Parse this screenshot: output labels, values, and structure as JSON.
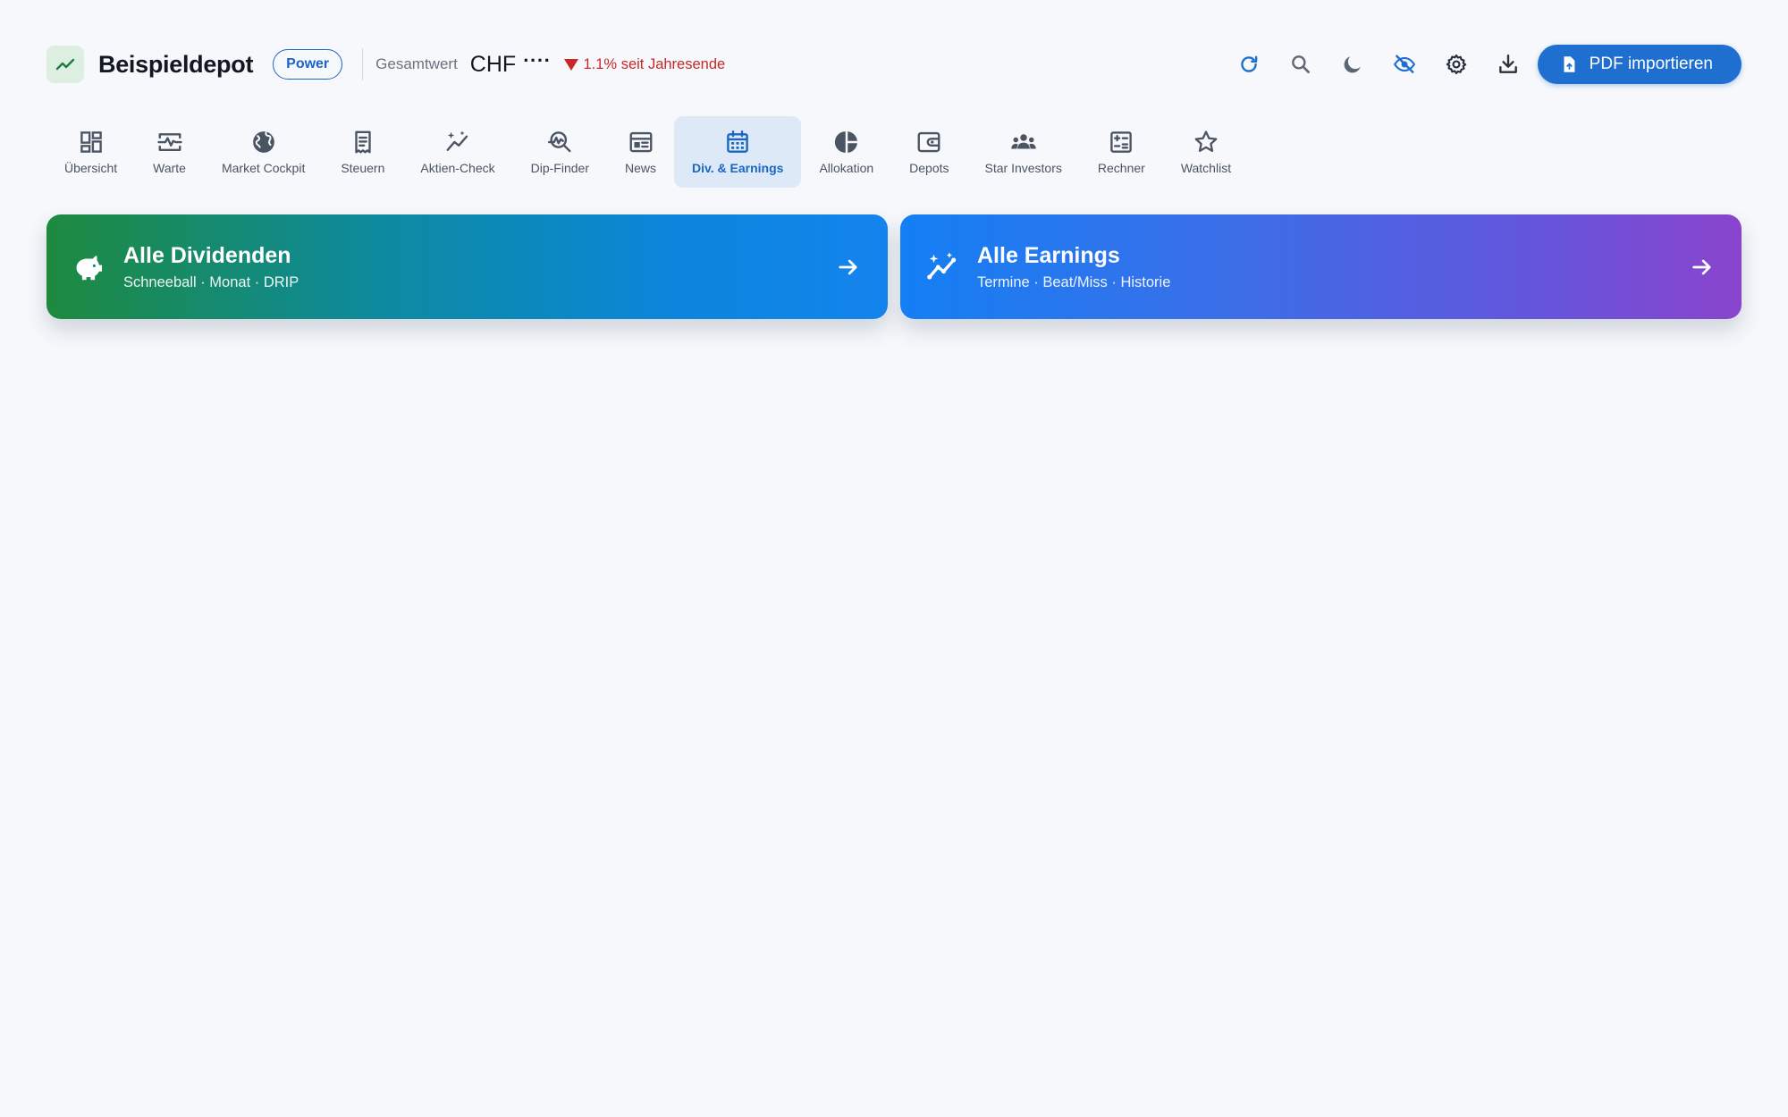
{
  "header": {
    "app_title": "Beispieldepot",
    "plan_badge": "Power",
    "total_label": "Gesamtwert",
    "total_currency": "CHF",
    "total_value_masked": "····",
    "change_text": "1.1% seit Jahresende",
    "change_direction": "down",
    "logo_icon": "trending-up-icon",
    "actions": [
      {
        "name": "refresh-icon"
      },
      {
        "name": "search-icon"
      },
      {
        "name": "dark-mode-icon"
      },
      {
        "name": "visibility-off-icon"
      },
      {
        "name": "settings-gear-icon"
      },
      {
        "name": "download-icon"
      }
    ],
    "import_button_label": "PDF importieren"
  },
  "nav": {
    "active_index": 7,
    "items": [
      {
        "label": "Übersicht",
        "icon": "dashboard-icon"
      },
      {
        "label": "Warte",
        "icon": "monitor-heart-icon"
      },
      {
        "label": "Market Cockpit",
        "icon": "globe-icon"
      },
      {
        "label": "Steuern",
        "icon": "receipt-icon"
      },
      {
        "label": "Aktien-Check",
        "icon": "auto-graph-icon"
      },
      {
        "label": "Dip-Finder",
        "icon": "query-stats-icon"
      },
      {
        "label": "News",
        "icon": "newspaper-icon"
      },
      {
        "label": "Div. & Earnings",
        "icon": "calendar-icon"
      },
      {
        "label": "Allokation",
        "icon": "donut-chart-icon"
      },
      {
        "label": "Depots",
        "icon": "wallet-icon"
      },
      {
        "label": "Star Investors",
        "icon": "groups-icon"
      },
      {
        "label": "Rechner",
        "icon": "calculator-icon"
      },
      {
        "label": "Watchlist",
        "icon": "star-icon"
      }
    ]
  },
  "cards": [
    {
      "title": "Alle Dividenden",
      "subtitle": "Schneeball · Monat · DRIP",
      "icon": "piggy-bank-icon"
    },
    {
      "title": "Alle Earnings",
      "subtitle": "Termine · Beat/Miss · Historie",
      "icon": "auto-graph-icon"
    }
  ],
  "colors": {
    "accent": "#1f6fd1",
    "negative": "#c62828",
    "nav_active_bg": "#dde9f7",
    "page_bg": "#f6f8fb"
  }
}
